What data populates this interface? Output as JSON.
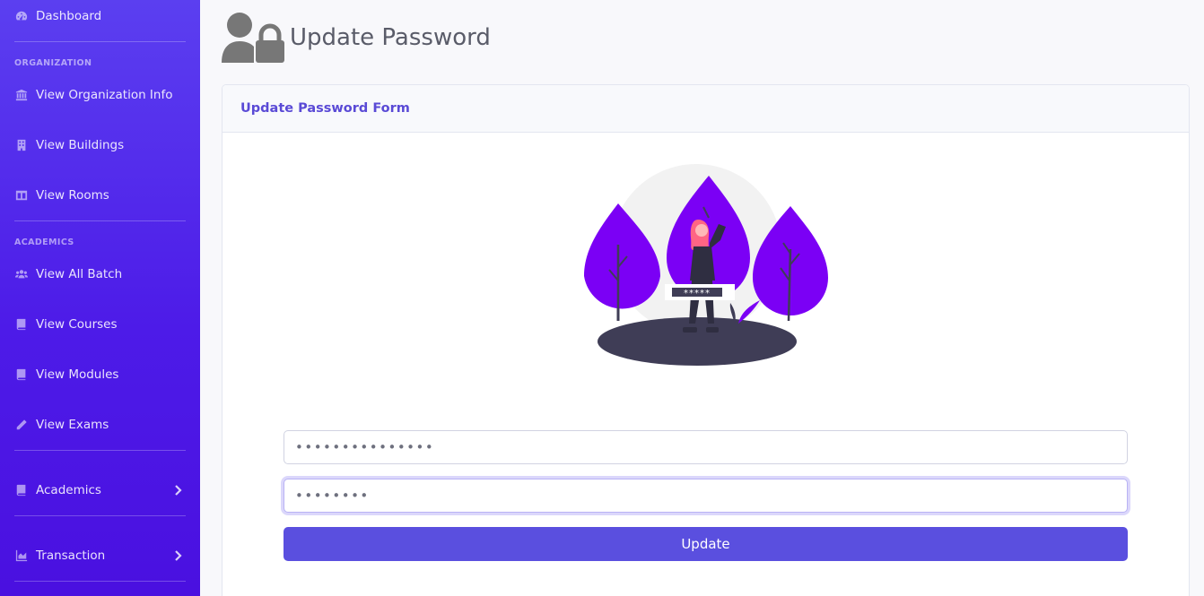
{
  "sidebar": {
    "dashboard": {
      "label": "Dashboard",
      "icon": "tachometer-icon"
    },
    "organization_heading": "ORGANIZATION",
    "view_organization_info": {
      "label": "View Organization Info",
      "icon": "university-icon"
    },
    "view_buildings": {
      "label": "View Buildings",
      "icon": "building-icon"
    },
    "view_rooms": {
      "label": "View Rooms",
      "icon": "columns-icon"
    },
    "academics_heading": "ACADEMICS",
    "view_all_batch": {
      "label": "View All Batch",
      "icon": "users-icon"
    },
    "view_courses": {
      "label": "View Courses",
      "icon": "book-icon"
    },
    "view_modules": {
      "label": "View Modules",
      "icon": "book-icon"
    },
    "view_exams": {
      "label": "View Exams",
      "icon": "pencil-icon"
    },
    "academics": {
      "label": "Academics",
      "icon": "book-icon"
    },
    "transaction": {
      "label": "Transaction",
      "icon": "chart-area-icon"
    }
  },
  "page": {
    "title": "Update Password",
    "title_icon": "user-lock-icon"
  },
  "card": {
    "title": "Update Password Form",
    "illustration_text": "*****"
  },
  "form": {
    "current_password_value": "•••••••••••••••",
    "new_password_value": "••••••••",
    "update_label": "Update"
  },
  "colors": {
    "sidebar_gradient_top": "#5b3ff0",
    "sidebar_gradient_bottom": "#4a10e0",
    "accent": "#5a4fdf",
    "card_title": "#5a4ad6",
    "illustration_purple": "#7b00f5"
  }
}
